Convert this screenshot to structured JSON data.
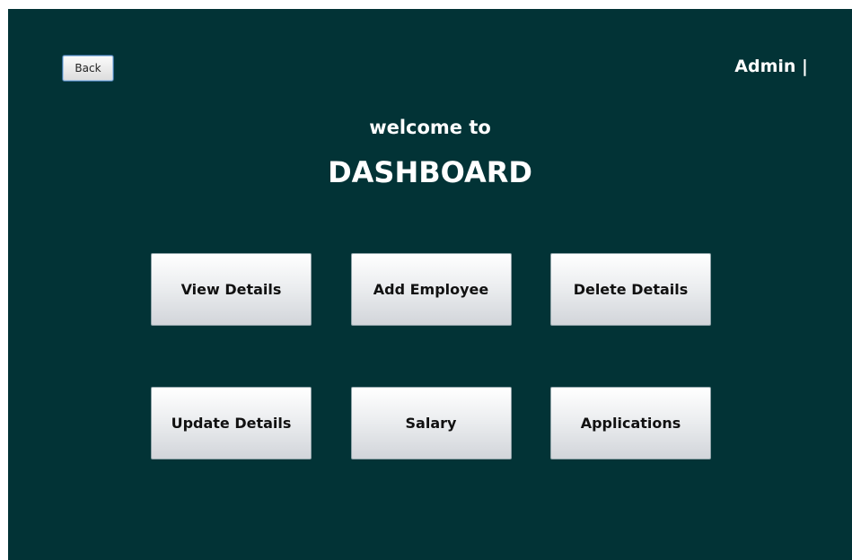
{
  "header": {
    "back_label": "Back",
    "user_label": "Admin |"
  },
  "main": {
    "welcome": "welcome to",
    "title": "DASHBOARD"
  },
  "actions": [
    {
      "label": "View Details"
    },
    {
      "label": "Add Employee"
    },
    {
      "label": "Delete Details"
    },
    {
      "label": "Update Details"
    },
    {
      "label": "Salary"
    },
    {
      "label": "Applications"
    }
  ],
  "colors": {
    "background": "#023336",
    "text": "#ffffff"
  }
}
